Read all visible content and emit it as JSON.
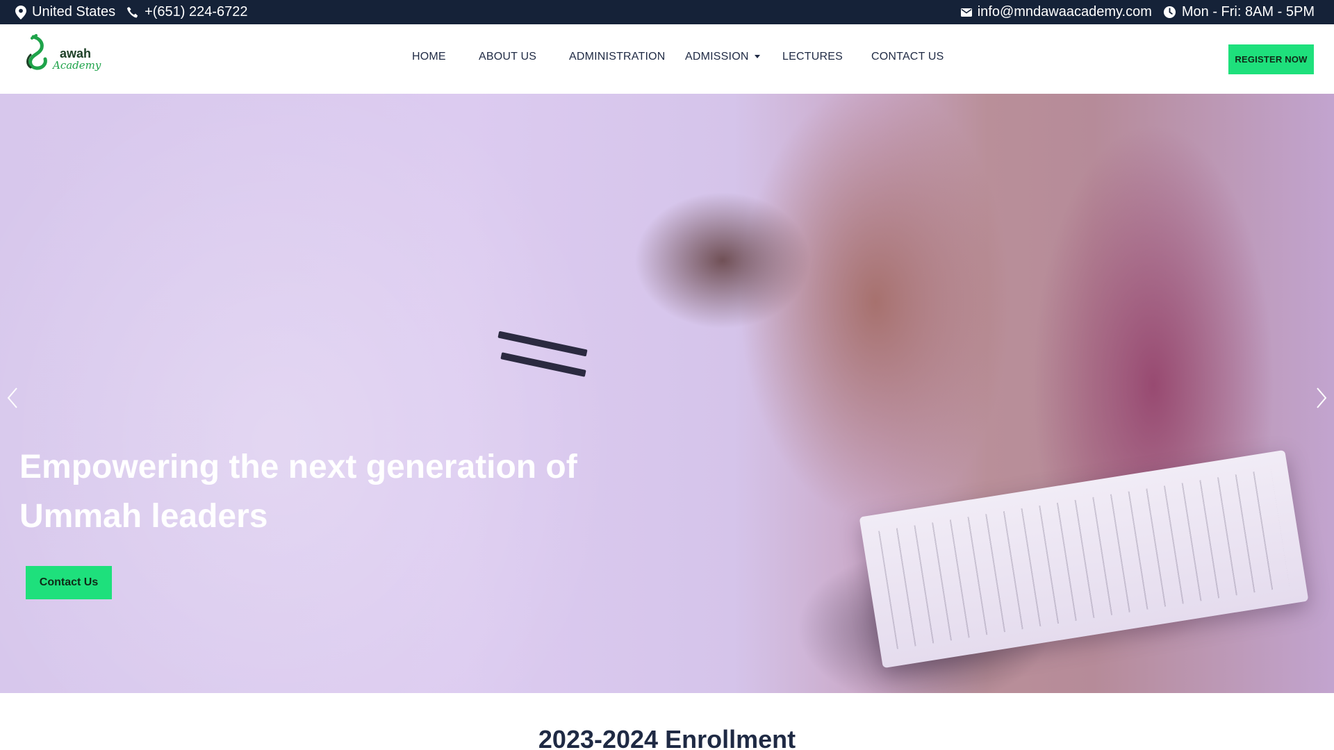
{
  "topbar": {
    "location": "United States",
    "phone": "+(651) 224-6722",
    "email": "info@mndawaacademy.com",
    "hours": "Mon - Fri: 8AM - 5PM",
    "icons": [
      "location-pin-icon",
      "phone-icon",
      "email-icon",
      "clock-icon"
    ]
  },
  "logo": {
    "word1": "awah",
    "word2": "Academy"
  },
  "nav": {
    "items": [
      {
        "label": "HOME"
      },
      {
        "label": "ABOUT US"
      },
      {
        "label": "ADMINISTRATION"
      },
      {
        "label": "ADMISSION",
        "dropdown": true
      },
      {
        "label": "LECTURES"
      },
      {
        "label": "CONTACT US"
      }
    ],
    "register_label": "REGISTER NOW"
  },
  "hero": {
    "title": "Empowering the next generation of Ummah leaders",
    "button_label": "Contact Us",
    "prev_icon": "chevron-left-icon",
    "next_icon": "chevron-right-icon"
  },
  "section": {
    "title": "2023-2024 Enrollment"
  },
  "colors": {
    "topbar_bg": "#152238",
    "accent_green": "#1ee07c",
    "text_dark": "#1f2a44"
  }
}
